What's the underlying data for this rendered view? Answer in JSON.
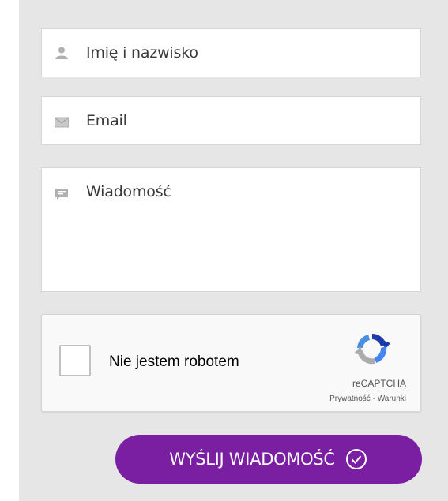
{
  "form": {
    "name_placeholder": "Imię i nazwisko",
    "email_placeholder": "Email",
    "message_placeholder": "Wiadomość"
  },
  "recaptcha": {
    "label": "Nie jestem robotem",
    "brand": "reCAPTCHA",
    "privacy": "Prywatność",
    "separator": " - ",
    "terms": "Warunki"
  },
  "submit": {
    "label": "WYŚLIJ WIADOMOŚĆ"
  },
  "colors": {
    "background": "#e6e6e6",
    "field_bg": "#ffffff",
    "accent": "#7b1fa2",
    "icon": "#b0b0b0"
  },
  "icons": {
    "name": "user-icon",
    "email": "envelope-icon",
    "message": "speech-bubble-icon",
    "submit": "check-circle-icon"
  }
}
